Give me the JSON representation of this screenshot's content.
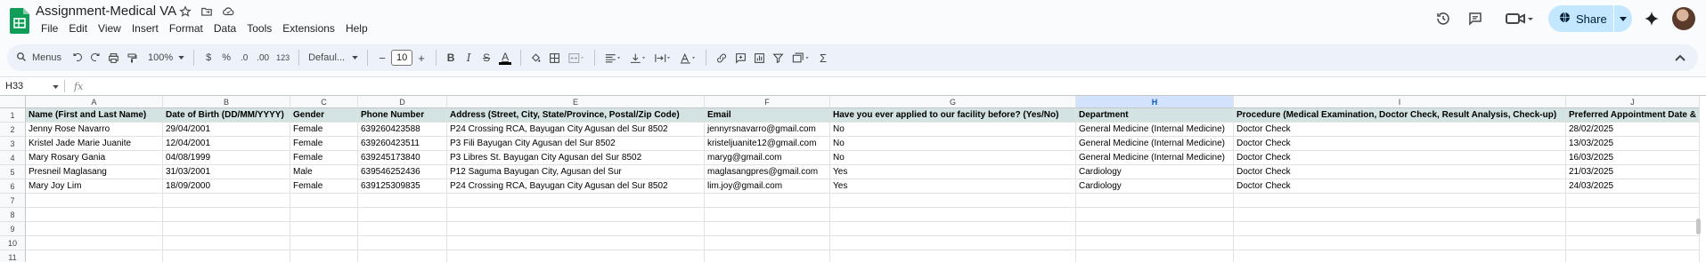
{
  "doc": {
    "title": "Assignment-Medical VA"
  },
  "menu": [
    "File",
    "Edit",
    "View",
    "Insert",
    "Format",
    "Data",
    "Tools",
    "Extensions",
    "Help"
  ],
  "share": {
    "label": "Share"
  },
  "toolbar": {
    "menus_label": "Menus",
    "zoom": "100%",
    "currency": "$",
    "percent": "%",
    "dec_decrease": ".0",
    "dec_increase": ".00",
    "number_format": "123",
    "font": "Defaul...",
    "font_size": "10",
    "minus": "−",
    "plus": "+",
    "bold": "B",
    "italic": "I",
    "strike": "S",
    "text_color": "A",
    "text_color_bar": "#000000",
    "sigma": "Σ"
  },
  "formula_bar": {
    "cell_ref": "H33",
    "fx": "fx",
    "value": ""
  },
  "sheet": {
    "columns": [
      "A",
      "B",
      "C",
      "D",
      "E",
      "F",
      "G",
      "H",
      "I",
      "J"
    ],
    "selected_column": "H",
    "row_numbers": [
      "1",
      "2",
      "3",
      "4",
      "5",
      "6",
      "7",
      "8",
      "9",
      "10",
      "11"
    ],
    "header": [
      "Name (First and Last Name)",
      "Date of Birth (DD/MM/YYYY)",
      "Gender",
      "Phone Number",
      "Address (Street, City, State/Province, Postal/Zip Code)",
      "Email",
      "Have you ever applied to our facility before? (Yes/No)",
      "Department",
      "Procedure (Medical Examination, Doctor Check, Result Analysis, Check-up)",
      "Preferred Appointment Date & T"
    ],
    "rows": [
      [
        "Jenny Rose Navarro",
        "29/04/2001",
        "Female",
        "639260423588",
        "P24 Crossing RCA, Bayugan City Agusan del Sur 8502",
        "jennyrsnavarro@gmail.com",
        "No",
        "General Medicine (Internal Medicine)",
        "Doctor Check",
        "28/02/2025"
      ],
      [
        "Kristel Jade Marie Juanite",
        "12/04/2001",
        "Female",
        "639260423511",
        "P3 Fili Bayugan City Agusan del Sur 8502",
        "kristeljuanite12@gmail.com",
        "No",
        "General Medicine (Internal Medicine)",
        "Doctor Check",
        "13/03/2025"
      ],
      [
        "Mary Rosary Gania",
        "04/08/1999",
        "Female",
        "639245173840",
        "P3 Libres St. Bayugan City Agusan del Sur 8502",
        "maryg@gmail.com",
        "No",
        "General Medicine (Internal Medicine)",
        "Doctor Check",
        "16/03/2025"
      ],
      [
        "Presneil Maglasang",
        "31/03/2001",
        "Male",
        "639546252436",
        "P12 Saguma Bayugan City, Agusan del Sur",
        "maglasangpres@gmail.com",
        "Yes",
        "Cardiology",
        "Doctor Check",
        "21/03/2025"
      ],
      [
        "Mary Joy Lim",
        "18/09/2000",
        "Female",
        "639125309835",
        "P24 Crossing RCA, Bayugan City Agusan del Sur 8502",
        "lim.joy@gmail.com",
        "Yes",
        "Cardiology",
        "Doctor Check",
        "24/03/2025"
      ]
    ]
  },
  "colors": {
    "header_fill": "#d3e2e2",
    "accent": "#0b57d0",
    "share_bg": "#c2e7ff",
    "logo": "#0f9d58"
  }
}
